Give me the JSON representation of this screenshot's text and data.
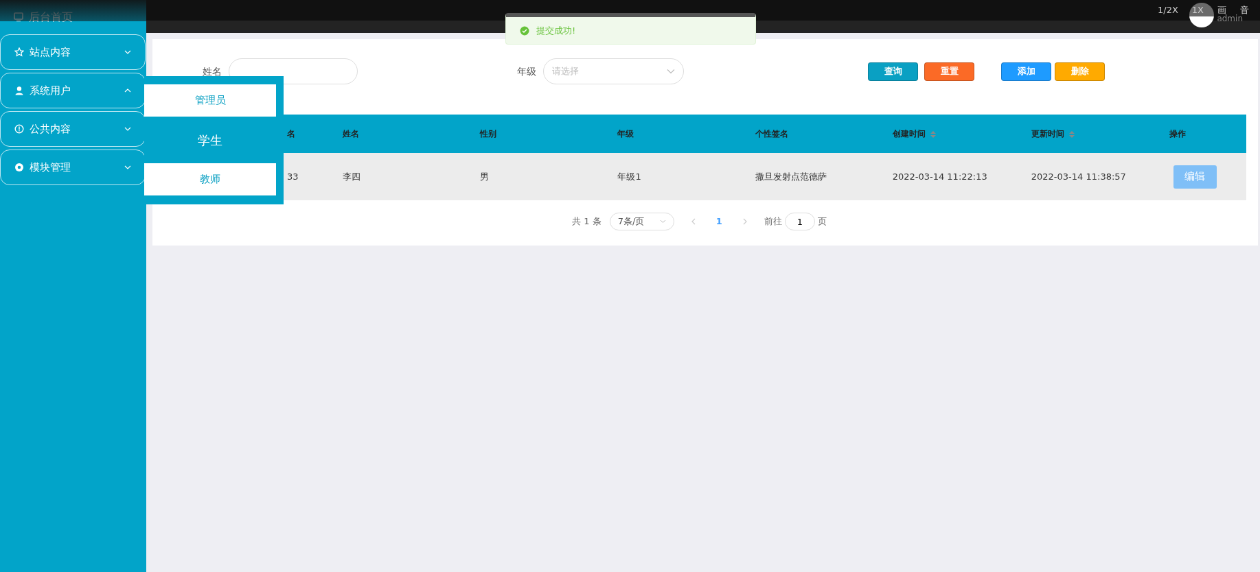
{
  "sidebar": {
    "home": {
      "label": "后台首页"
    },
    "items": [
      {
        "label": "站点内容",
        "expanded": false
      },
      {
        "label": "系统用户",
        "expanded": true,
        "children": [
          {
            "label": "管理员",
            "selected": false
          },
          {
            "label": "学生",
            "selected": true
          },
          {
            "label": "教师",
            "selected": false
          }
        ]
      },
      {
        "label": "公共内容",
        "expanded": false
      },
      {
        "label": "模块管理",
        "expanded": false
      }
    ]
  },
  "topbar": {
    "speeds": [
      "1/2X",
      "1X"
    ],
    "user": "admin",
    "buttons": [
      "画",
      "音"
    ]
  },
  "toast": {
    "kind": "success",
    "text": "提交成功!"
  },
  "search": {
    "fields": [
      {
        "kind": "input",
        "label": "姓名"
      },
      {
        "kind": "select",
        "label": "年级",
        "placeholder": "请选择"
      }
    ],
    "buttons": [
      {
        "label": "查询",
        "color": "#0aa0c3"
      },
      {
        "label": "重置",
        "color": "#fb6a26"
      },
      {
        "label": "添加",
        "color": "#1e9bff"
      },
      {
        "label": "删除",
        "color": "#ffaa00"
      }
    ]
  },
  "table": {
    "columns": [
      {
        "label": "名",
        "sortable": false
      },
      {
        "label": "姓名",
        "sortable": false
      },
      {
        "label": "性别",
        "sortable": false
      },
      {
        "label": "年级",
        "sortable": false
      },
      {
        "label": "个性签名",
        "sortable": false
      },
      {
        "label": "创建时间",
        "sortable": true
      },
      {
        "label": "更新时间",
        "sortable": true
      },
      {
        "label": "操作",
        "sortable": false
      }
    ],
    "rows": [
      {
        "cells": [
          "33",
          "李四",
          "男",
          "年级1",
          "撒旦发射点范德萨",
          "2022-03-14 11:22:13",
          "2022-03-14 11:38:57"
        ],
        "action": "编辑"
      }
    ]
  },
  "pagination": {
    "total": "共 1 条",
    "page_size": "7条/页",
    "pages": [
      {
        "label": "1",
        "selected": true
      }
    ],
    "goto_label": "前往",
    "goto_value": "1",
    "goto_suffix": "页"
  }
}
